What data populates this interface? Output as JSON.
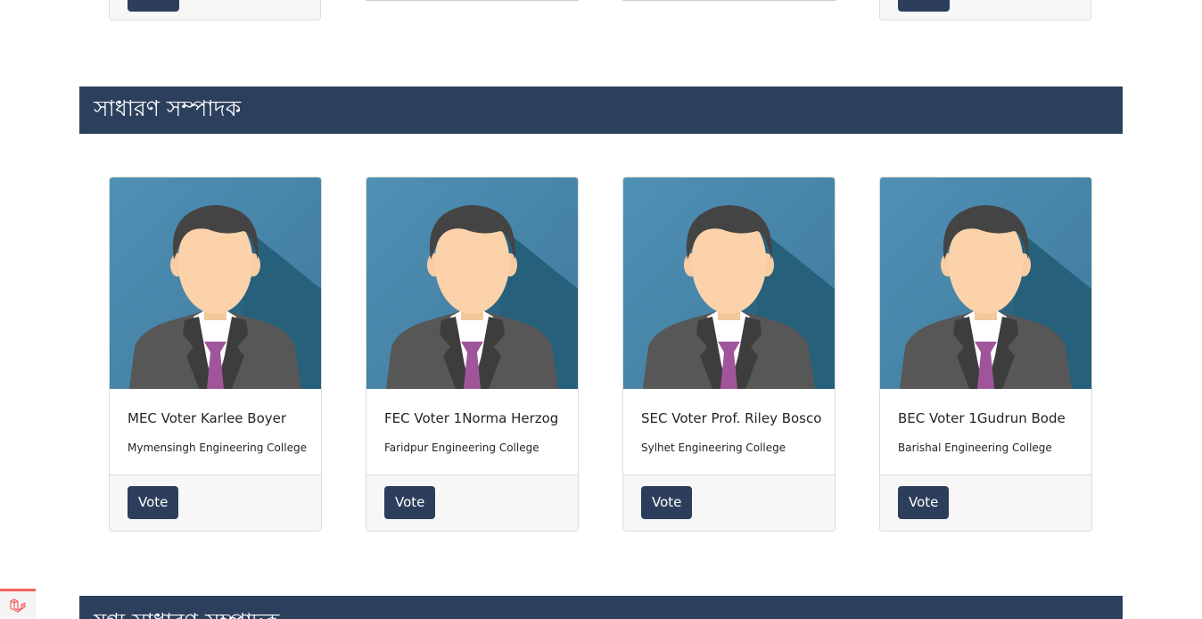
{
  "sections": {
    "general_secretary": {
      "title": "সাধারণ সম্পাদক"
    },
    "joint_general_secretary": {
      "title": "যুগ্ম সাধারণ সম্পাদক"
    }
  },
  "candidates": [
    {
      "name": "MEC Voter Karlee Boyer",
      "college": "Mymensingh Engineering College",
      "vote_label": "Vote"
    },
    {
      "name": "FEC Voter 1Norma Herzog",
      "college": "Faridpur Engineering College",
      "vote_label": "Vote"
    },
    {
      "name": "SEC Voter Prof. Riley Bosco",
      "college": "Sylhet Engineering College",
      "vote_label": "Vote"
    },
    {
      "name": "BEC Voter 1Gudrun Bode",
      "college": "Barishal Engineering College",
      "vote_label": "Vote"
    }
  ],
  "icons": {
    "avatar": "person-avatar-icon",
    "debug": "laravel-icon"
  },
  "colors": {
    "header_bg": "#2c405e",
    "button_bg": "#2c3e5c",
    "avatar_bg": "#4a8aae",
    "tie": "#a0559b"
  }
}
